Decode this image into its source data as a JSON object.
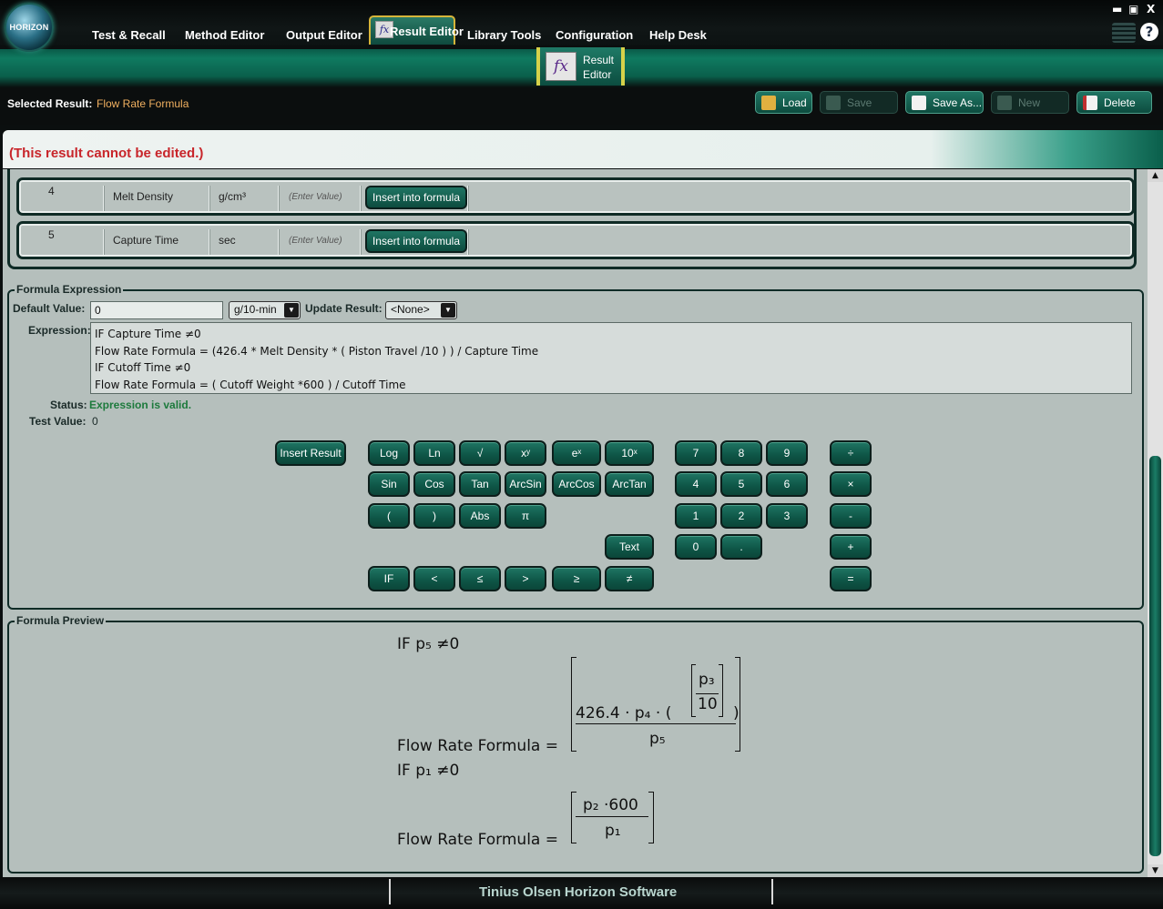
{
  "app": {
    "logo_text": "HORIZON",
    "footer": "Tinius Olsen Horizon Software"
  },
  "window_controls": {
    "minimize": "▬",
    "restore": "▣",
    "close": "X"
  },
  "menu": [
    "Test & Recall",
    "Method Editor",
    "Output Editor",
    "Result Editor",
    "Library Tools",
    "Configuration",
    "Help Desk"
  ],
  "active_menu": "Result Editor",
  "ribbon": {
    "button_line1": "Result",
    "button_line2": "Editor",
    "icon_text": "fx"
  },
  "selected_result": {
    "label": "Selected Result:",
    "value": "Flow Rate Formula"
  },
  "toolbar": {
    "load": "Load",
    "save": "Save",
    "save_as": "Save As...",
    "new": "New",
    "delete": "Delete"
  },
  "warning": "(This result cannot be edited.)",
  "parameters": [
    {
      "index": "4",
      "name": "Melt Density",
      "unit": "g/cm³",
      "value": "(Enter Value)",
      "button": "Insert into formula"
    },
    {
      "index": "5",
      "name": "Capture Time",
      "unit": "sec",
      "value": "(Enter Value)",
      "button": "Insert into formula"
    }
  ],
  "formula_expression": {
    "title": "Formula Expression",
    "default_value_label": "Default Value:",
    "default_value": "0",
    "unit_selected": "g/10-min",
    "update_result_label": "Update Result:",
    "update_result_selected": "<None>",
    "expression_label": "Expression:",
    "expression_lines": [
      "IF Capture Time ≠0",
      "Flow Rate Formula = (426.4 * Melt Density * ( Piston Travel /10 ) ) / Capture Time",
      "IF Cutoff Time ≠0",
      "Flow Rate Formula = ( Cutoff Weight *600 ) / Cutoff Time"
    ],
    "status_label": "Status:",
    "status_value": "Expression is valid.",
    "test_value_label": "Test Value:",
    "test_value": "0"
  },
  "keypad": {
    "insert_result": "Insert Result",
    "functions": [
      "Log",
      "Ln",
      "√",
      "xʸ",
      "eˣ",
      "10ˣ",
      "Sin",
      "Cos",
      "Tan",
      "ArcSin",
      "ArcCos",
      "ArcTan",
      "(",
      ")",
      "Abs",
      "π",
      "Text"
    ],
    "comparisons": [
      "IF",
      "<",
      "≤",
      ">",
      "≥",
      "≠"
    ],
    "digits": [
      "7",
      "8",
      "9",
      "4",
      "5",
      "6",
      "1",
      "2",
      "3",
      "0",
      "."
    ],
    "operators": [
      "÷",
      "×",
      "-",
      "+",
      "="
    ]
  },
  "preview": {
    "title": "Formula Preview",
    "if1": "IF p₅ ≠0",
    "lhs1": "Flow Rate Formula =",
    "num1_a": "426.4 · p₄ · (",
    "num1_inner_num": "p₃",
    "num1_inner_den": "10",
    "num1_close": ")",
    "den1": "p₅",
    "if2": "IF p₁ ≠0",
    "lhs2": "Flow Rate Formula =",
    "num2": "p₂ ·600",
    "den2": "p₁"
  },
  "colors": {
    "accent_green": "#0f5c4b",
    "warning_red": "#c8252a",
    "status_green": "#1d7a3c",
    "selected_orange": "#f0b060"
  }
}
